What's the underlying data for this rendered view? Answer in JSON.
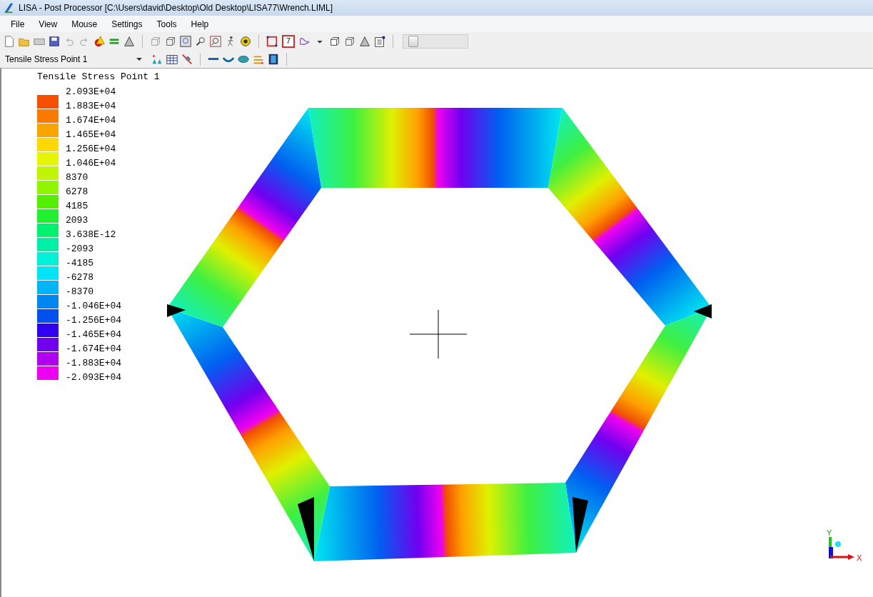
{
  "window": {
    "title": "LISA - Post Processor [C:\\Users\\david\\Desktop\\Old Desktop\\LISA77\\Wrench.LIML]"
  },
  "menu": [
    "File",
    "View",
    "Mouse",
    "Settings",
    "Tools",
    "Help"
  ],
  "toolbar": {
    "number_tool": "7",
    "frame_slider": {
      "level": 0.08
    }
  },
  "result_selector": {
    "value": "Tensile Stress Point 1"
  },
  "legend": {
    "title": "Tensile Stress Point 1",
    "labels": [
      "2.093E+04",
      "1.883E+04",
      "1.674E+04",
      "1.465E+04",
      "1.256E+04",
      "1.046E+04",
      "8370",
      "6278",
      "4185",
      "2093",
      "3.638E-12",
      "-2093",
      "-4185",
      "-6278",
      "-8370",
      "-1.046E+04",
      "-1.256E+04",
      "-1.465E+04",
      "-1.674E+04",
      "-1.883E+04",
      "-2.093E+04"
    ],
    "swatches": [
      {
        "color": "#f55000"
      },
      {
        "color": "#f87a00"
      },
      {
        "color": "#faa400"
      },
      {
        "color": "#ffd800"
      },
      {
        "color": "#e6f500"
      },
      {
        "color": "#bff500"
      },
      {
        "color": "#8ff500"
      },
      {
        "color": "#55f000"
      },
      {
        "color": "#20f030"
      },
      {
        "color": "#00f070"
      },
      {
        "color": "#00f0a8"
      },
      {
        "color": "#00f0d8"
      },
      {
        "color": "#00e4f5"
      },
      {
        "color": "#00b4fa"
      },
      {
        "color": "#0086f0"
      },
      {
        "color": "#0050f0"
      },
      {
        "color": "#3000f0"
      },
      {
        "color": "#7000f0"
      },
      {
        "color": "#b000f0"
      },
      {
        "color": "#f000f0"
      }
    ]
  },
  "axes": {
    "x_label": "X",
    "y_label": "Y"
  }
}
